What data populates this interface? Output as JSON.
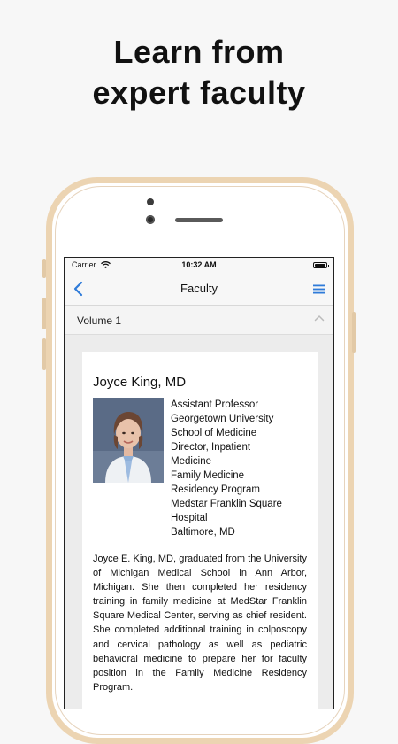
{
  "promo": {
    "headline_line1": "Learn from",
    "headline_line2": "expert faculty"
  },
  "status_bar": {
    "carrier": "Carrier",
    "time": "10:32 AM"
  },
  "navbar": {
    "title": "Faculty",
    "back_icon": "chevron-left-icon",
    "menu_icon": "hamburger-menu-icon",
    "accent_color": "#2f7bd9"
  },
  "section": {
    "label": "Volume 1",
    "toggle_icon": "chevron-up-icon"
  },
  "faculty": {
    "name": "Joyce King, MD",
    "titles": [
      "Assistant Professor",
      "Georgetown University",
      "School of Medicine",
      "Director, Inpatient",
      "Medicine",
      "Family Medicine",
      "Residency Program",
      "Medstar Franklin Square",
      "Hospital",
      "Baltimore, MD"
    ],
    "bio": "Joyce E. King, MD, graduated from the University of Michigan Medical School in Ann Arbor, Michigan. She then completed her residency training in family medicine at MedStar Franklin Square Medical Center, serving as chief resident. She completed additional training in colposcopy and cervical pathology as well as pediatric behavioral medicine to prepare her for faculty position in the Family Medicine Residency Program."
  }
}
